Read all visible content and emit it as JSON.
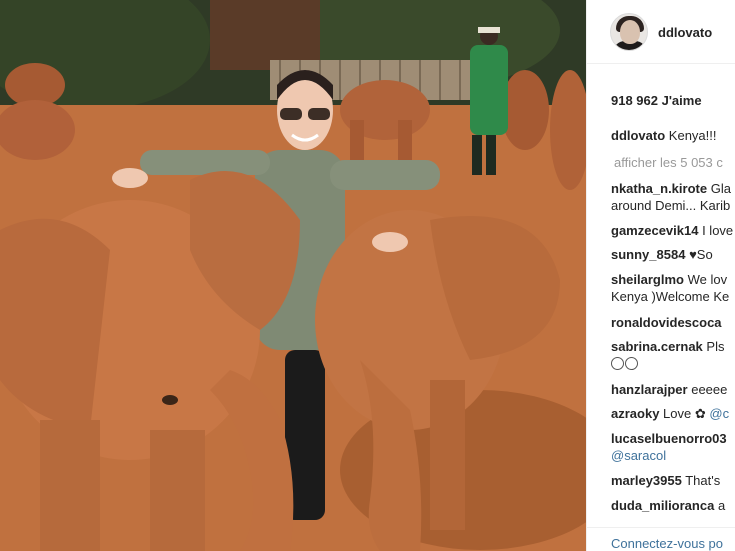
{
  "post": {
    "image_description_icon": "photo",
    "username": "ddlovato",
    "likes": "918 962 J'aime",
    "caption_user": "ddlovato",
    "caption_text": "Kenya!!!",
    "view_all": "afficher les 5 053 c",
    "comments": [
      {
        "user": "nkatha_n.kirote",
        "text": "Gla",
        "line2": "around Demi... Karib"
      },
      {
        "user": "gamzecevik14",
        "text": "I love"
      },
      {
        "user": "sunny_8584",
        "text": "So"
      },
      {
        "user": "sheilarglmo",
        "text": "We lov",
        "line2": "Kenya )Welcome Ke"
      },
      {
        "user": "ronaldovidescoca",
        "text": ""
      },
      {
        "user": "sabrina.cernak",
        "text": "Pls"
      },
      {
        "user": "hanzlarajper",
        "text": "eeeee"
      },
      {
        "user": "azraoky",
        "text": "Love",
        "mention": "@c"
      },
      {
        "user": "lucaselbuenorro03",
        "text": "",
        "line2": "@saracol"
      },
      {
        "user": "marley3955",
        "text": "That's"
      },
      {
        "user": "duda_milioranca",
        "text": "a"
      }
    ],
    "login_link": "Connectez-vous po"
  },
  "colors": {
    "link": "#3f729b",
    "text": "#262626",
    "muted": "#999999",
    "divider": "#efefef"
  },
  "icons": {
    "heart": "♥",
    "flower": "✿"
  }
}
